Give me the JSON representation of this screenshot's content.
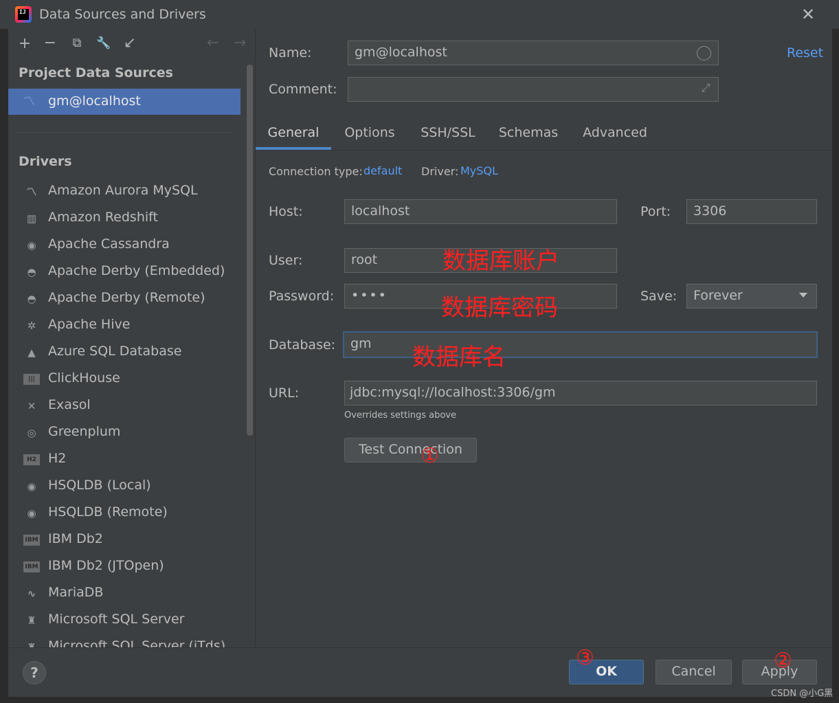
{
  "window": {
    "title": "Data Sources and Drivers",
    "close_glyph": "✕"
  },
  "toolbar": {
    "add": "+",
    "remove": "−",
    "copy": "⧉",
    "settings": "🔧",
    "import": "↙",
    "back": "←",
    "forward": "→"
  },
  "left": {
    "project_heading": "Project Data Sources",
    "selected_source": "gm@localhost",
    "drivers_heading": "Drivers",
    "drivers": [
      {
        "label": "Amazon Aurora MySQL",
        "icon": "dolphin-icon"
      },
      {
        "label": "Amazon Redshift",
        "icon": "redshift-icon"
      },
      {
        "label": "Apache Cassandra",
        "icon": "eye-icon"
      },
      {
        "label": "Apache Derby (Embedded)",
        "icon": "hat-icon"
      },
      {
        "label": "Apache Derby (Remote)",
        "icon": "hat-icon"
      },
      {
        "label": "Apache Hive",
        "icon": "bee-icon"
      },
      {
        "label": "Azure SQL Database",
        "icon": "azure-icon"
      },
      {
        "label": "ClickHouse",
        "icon": "bars-icon"
      },
      {
        "label": "Exasol",
        "icon": "x-icon"
      },
      {
        "label": "Greenplum",
        "icon": "circle-icon"
      },
      {
        "label": "H2",
        "icon": "h2-icon"
      },
      {
        "label": "HSQLDB (Local)",
        "icon": "spiral-icon"
      },
      {
        "label": "HSQLDB (Remote)",
        "icon": "spiral-icon"
      },
      {
        "label": "IBM Db2",
        "icon": "ibm-icon"
      },
      {
        "label": "IBM Db2 (JTOpen)",
        "icon": "ibm-icon"
      },
      {
        "label": "MariaDB",
        "icon": "seal-icon"
      },
      {
        "label": "Microsoft SQL Server",
        "icon": "mssql-icon"
      },
      {
        "label": "Microsoft SQL Server (jTds)",
        "icon": "mssql-icon"
      }
    ]
  },
  "form": {
    "name_label": "Name:",
    "name_value": "gm@localhost",
    "comment_label": "Comment:",
    "comment_value": "",
    "reset_label": "Reset",
    "tabs": [
      "General",
      "Options",
      "SSH/SSL",
      "Schemas",
      "Advanced"
    ],
    "active_tab": "General",
    "connection_type_label": "Connection type:",
    "connection_type_value": "default",
    "driver_label": "Driver:",
    "driver_value": "MySQL",
    "host_label": "Host:",
    "host_value": "localhost",
    "port_label": "Port:",
    "port_value": "3306",
    "user_label": "User:",
    "user_value": "root",
    "password_label": "Password:",
    "password_value": "••••",
    "save_label": "Save:",
    "save_value": "Forever",
    "database_label": "Database:",
    "database_value": "gm",
    "url_label": "URL:",
    "url_value": "jdbc:mysql://localhost:3306/gm",
    "url_hint": "Overrides settings above",
    "test_connection": "Test Connection"
  },
  "annotations": {
    "user_note": "数据库账户",
    "password_note": "数据库密码",
    "database_note": "数据库名",
    "step1": "①",
    "step2": "②",
    "step3": "③"
  },
  "buttons": {
    "help": "?",
    "ok": "OK",
    "cancel": "Cancel",
    "apply": "Apply"
  },
  "watermark": "CSDN @小G黑",
  "colors": {
    "accent": "#4a88c7",
    "selection": "#4b6eaf",
    "link": "#589df6",
    "annotation": "#ff2020"
  }
}
